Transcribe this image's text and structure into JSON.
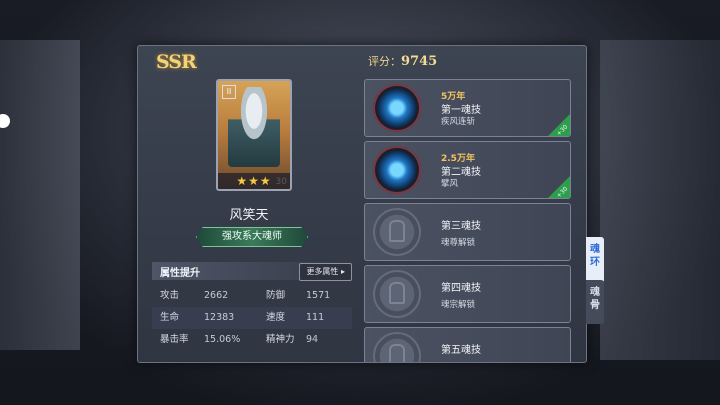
{
  "hero": {
    "rarity": "SSR",
    "name": "风笑天",
    "class_label": "强攻系大魂师",
    "level": "30",
    "stars": "★★★"
  },
  "attributes": {
    "title": "属性提升",
    "more_label": "更多属性 ▸",
    "rows": [
      {
        "l1": "攻击",
        "v1": "2662",
        "l2": "防御",
        "v2": "1571"
      },
      {
        "l1": "生命",
        "v1": "12383",
        "l2": "速度",
        "v2": "111"
      },
      {
        "l1": "暴击率",
        "v1": "15.06%",
        "l2": "精神力",
        "v2": "94"
      }
    ]
  },
  "score": {
    "label": "评分：",
    "value": "9745"
  },
  "rings": [
    {
      "age": "5万年",
      "title": "第一魂技",
      "desc": "疾风连斩",
      "locked": false,
      "corner": "+30"
    },
    {
      "age": "2.5万年",
      "title": "第二魂技",
      "desc": "擘风",
      "locked": false,
      "corner": "+30"
    },
    {
      "age": "",
      "title": "第三魂技",
      "desc": "魂尊解锁",
      "locked": true
    },
    {
      "age": "",
      "title": "第四魂技",
      "desc": "魂宗解锁",
      "locked": true
    },
    {
      "age": "",
      "title": "第五魂技",
      "desc": "",
      "locked": true
    }
  ],
  "side_tabs": {
    "ring": "魂\n环",
    "bone": "魂\n骨"
  },
  "colors": {
    "accent_gold": "#f3d27a",
    "active_tab": "#2c6ad6",
    "corner_green": "#2e9e4e"
  }
}
